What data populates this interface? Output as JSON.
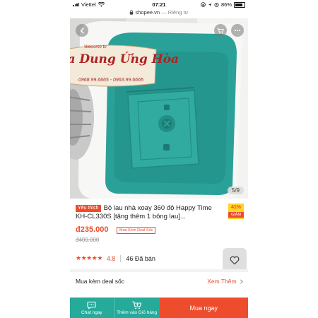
{
  "status_bar": {
    "carrier": "Viettel",
    "time": "07:21",
    "battery": "86%"
  },
  "url_bar": {
    "domain": "shopee.vn",
    "separator": "—",
    "privacy": "Riêng tư"
  },
  "product_image": {
    "counter": "5/9",
    "watermark_subtitle": "Welcome to",
    "watermark_title": "ia Dung Ứng Hòa",
    "watermark_phone": "0968.99.6665 - 0963.99.6665"
  },
  "product": {
    "favorite_tag": "Yêu thích",
    "title": "Bộ lau nhà xoay 360 độ Happy Time KH-CL330S [tặng thêm 1 bông lau]...",
    "discount_percent": "41%",
    "discount_label": "GIẢM",
    "price": "đ235.000",
    "deal_badge": "Mua Kèm Deal Sốc",
    "old_price": "đ400.000",
    "rating_stars": 5,
    "rating_score": "4.8",
    "sold": "46 Đã bán"
  },
  "deal_section": {
    "label": "Mua kèm deal sốc",
    "see_more": "Xem Thêm"
  },
  "bottom_bar": {
    "chat_label": "Chat ngay",
    "cart_label": "Thêm vào Giỏ hàng",
    "buy_label": "Mua ngay"
  },
  "colors": {
    "brand": "#ee4d2d",
    "chat_green": "#26aa99",
    "bucket_teal": "#2aa198"
  },
  "icons": [
    "wifi-icon",
    "lock-icon",
    "location-icon",
    "alarm-icon",
    "back-icon",
    "cart-icon",
    "more-icon",
    "heart-icon",
    "chat-icon",
    "add-to-cart-icon",
    "chevron-right-icon",
    "star-icon"
  ]
}
